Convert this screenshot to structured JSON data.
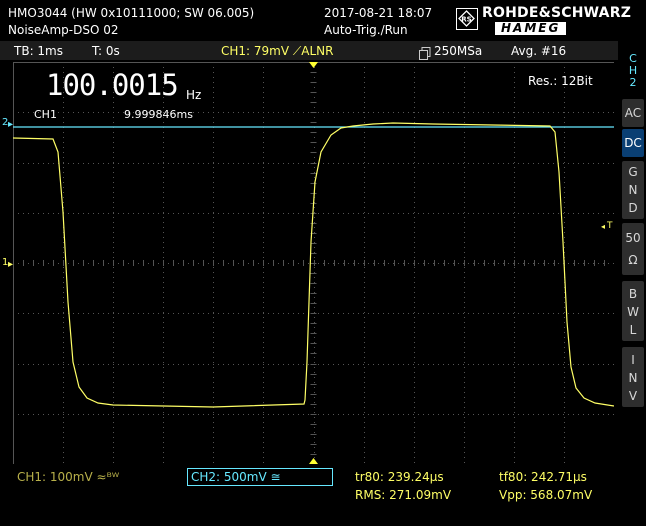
{
  "header": {
    "model_line": "HMO3044 (HW 0x10111000; SW 06.005)",
    "device_name": "NoiseAmp-DSO 02",
    "datetime": "2017-08-21 18:07",
    "trigger_mode": "Auto-Trig./Run",
    "brand_top": "ROHDE&SCHWARZ",
    "brand_bottom": "HAMEG"
  },
  "status": {
    "timebase": "TB: 1ms",
    "time_offset": "T: 0s",
    "trigger_info": "CH1: 79mV ⟋ALNR",
    "sample_rate": "250MSa",
    "averaging": "Avg. #16"
  },
  "measure": {
    "frequency_value": "100.0015",
    "frequency_unit": "Hz",
    "freq_channel": "CH1",
    "period": "9.999846ms",
    "resolution": "Res.: 12Bit"
  },
  "bottom": {
    "ch1_setting": "CH1: 100mV ≈ᴮᵂ",
    "ch2_setting": "CH2: 500mV ≅",
    "tr80": "tr80: 239.24µs",
    "tf80": "tf80: 242.71µs",
    "rms": "RMS: 271.09mV",
    "vpp": "Vpp: 568.07mV"
  },
  "markers": {
    "ch2_ref": "2",
    "ch1_ref": "1",
    "trigger_level": "T"
  },
  "side_panel": {
    "channel_label": [
      "C",
      "H",
      "2"
    ],
    "ac": "AC",
    "dc": "DC",
    "gnd": [
      "G",
      "N",
      "D"
    ],
    "fifty_ohm": [
      "50",
      "Ω"
    ],
    "bwl": [
      "B",
      "W",
      "L"
    ],
    "inv": [
      "I",
      "N",
      "V"
    ]
  },
  "colors": {
    "ch1": "#ffff66",
    "ch2": "#66e8ff",
    "grid": "#555555",
    "active_button": "#0a3f73"
  }
}
